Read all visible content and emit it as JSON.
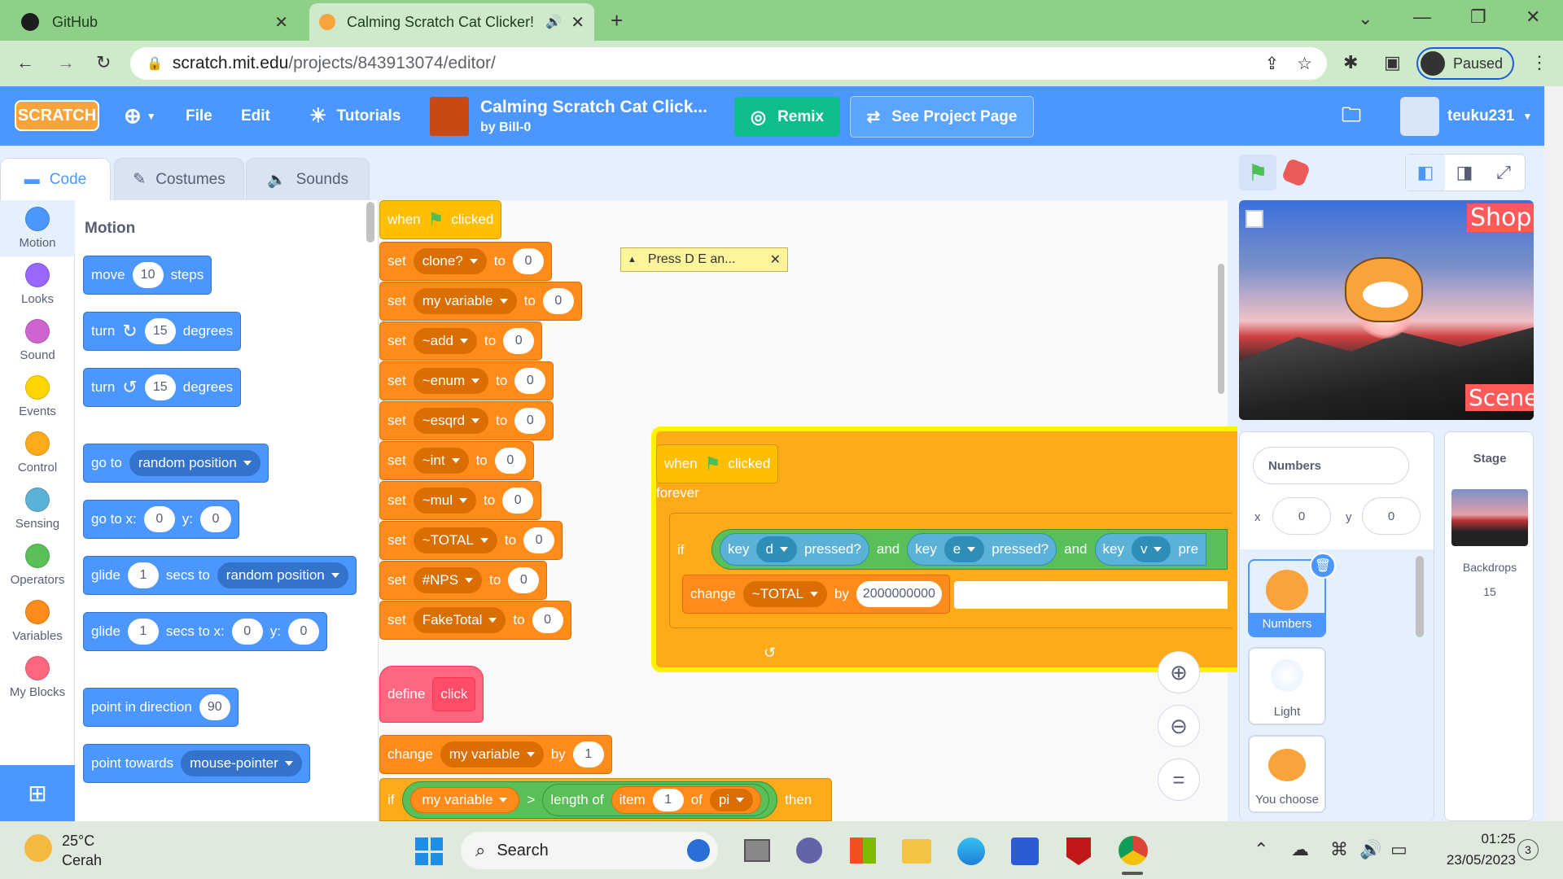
{
  "browser": {
    "tabs": [
      {
        "label": "GitHub",
        "icon": "github-icon"
      },
      {
        "label": "Calming Scratch Cat Clicker!",
        "icon": "scratch-favicon"
      }
    ],
    "url_host": "scratch.mit.edu",
    "url_path": "/projects/843913074/editor/",
    "profile_label": "Paused"
  },
  "header": {
    "logo": "SCRATCH",
    "file": "File",
    "edit": "Edit",
    "tutorials": "Tutorials",
    "project_title": "Calming Scratch Cat Click...",
    "author": "by Bill-0",
    "remix": "Remix",
    "see_project": "See Project Page",
    "username": "teuku231"
  },
  "tabs": {
    "code": "Code",
    "costumes": "Costumes",
    "sounds": "Sounds"
  },
  "categories": [
    {
      "label": "Motion",
      "color": "#4c97ff"
    },
    {
      "label": "Looks",
      "color": "#9966ff"
    },
    {
      "label": "Sound",
      "color": "#cf63cf"
    },
    {
      "label": "Events",
      "color": "#ffd500"
    },
    {
      "label": "Control",
      "color": "#ffab19"
    },
    {
      "label": "Sensing",
      "color": "#5cb1d6"
    },
    {
      "label": "Operators",
      "color": "#59c059"
    },
    {
      "label": "Variables",
      "color": "#ff8c1a"
    },
    {
      "label": "My Blocks",
      "color": "#ff6680"
    }
  ],
  "palette": {
    "heading": "Motion",
    "move": "move",
    "move_val": "10",
    "steps": "steps",
    "turn": "turn",
    "turn_val": "15",
    "degrees": "degrees",
    "goto": "go to",
    "random_position": "random position",
    "goto_xy": "go to x:",
    "x0": "0",
    "y_lbl": "y:",
    "y0": "0",
    "glide": "glide",
    "glide_val": "1",
    "secs_to": "secs to",
    "secs_to_x": "secs to x:",
    "point_dir": "point in direction",
    "dir_val": "90",
    "point_towards": "point towards",
    "mouse_pointer": "mouse-pointer"
  },
  "script1": {
    "when": "when",
    "clicked": "clicked",
    "set": "set",
    "to": "to",
    "vars": [
      {
        "name": "clone?",
        "val": "0"
      },
      {
        "name": "my variable",
        "val": "0"
      },
      {
        "name": "~add",
        "val": "0"
      },
      {
        "name": "~enum",
        "val": "0"
      },
      {
        "name": "~esqrd",
        "val": "0"
      },
      {
        "name": "~int",
        "val": "0"
      },
      {
        "name": "~mul",
        "val": "0"
      },
      {
        "name": "~TOTAL",
        "val": "0"
      },
      {
        "name": "#NPS",
        "val": "0"
      },
      {
        "name": "FakeTotal",
        "val": "0"
      }
    ]
  },
  "comment": "Press D E an...",
  "script2": {
    "when": "when",
    "clicked": "clicked",
    "forever": "forever",
    "if": "if",
    "key": "key",
    "pressed": "pressed?",
    "and": "and",
    "k1": "d",
    "k2": "e",
    "k3": "v",
    "pre": "pre",
    "change": "change",
    "var": "~TOTAL",
    "by": "by",
    "amount": "2000000000"
  },
  "script3": {
    "define": "define",
    "name": "click",
    "change": "change",
    "var": "my variable",
    "by": "by",
    "amount": "1",
    "if": "if",
    "gt": ">",
    "length_of": "length of",
    "item": "item",
    "item_idx": "1",
    "of": "of",
    "list": "pi",
    "then": "then"
  },
  "stage": {
    "shop": "Shop",
    "scene": "Scene"
  },
  "sprite_info": {
    "name": "Numbers",
    "x_lbl": "x",
    "x": "0",
    "y_lbl": "y",
    "y": "0"
  },
  "sprites": [
    {
      "name": "Numbers"
    },
    {
      "name": "Light"
    },
    {
      "name": "You choose"
    }
  ],
  "stage_pane": {
    "title": "Stage",
    "backdrops_lbl": "Backdrops",
    "backdrops": "15"
  },
  "taskbar": {
    "temp": "25°C",
    "weather": "Cerah",
    "search": "Search",
    "time": "01:25",
    "date": "23/05/2023",
    "badge": "3"
  }
}
